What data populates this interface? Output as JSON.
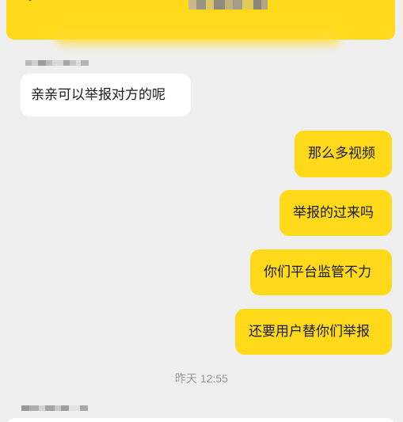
{
  "header": {
    "back_icon": "chevron-left-icon",
    "accent_color": "#ffd91a"
  },
  "messages": [
    {
      "side": "left",
      "text": "亲亲可以举报对方的呢"
    },
    {
      "side": "right",
      "text": "那么多视频"
    },
    {
      "side": "right",
      "text": "举报的过来吗"
    },
    {
      "side": "right",
      "text": "你们平台监管不力"
    },
    {
      "side": "right",
      "text": "还要用户替你们举报"
    }
  ],
  "timestamp": "昨天 12:55",
  "colors": {
    "background": "#efefef",
    "incoming_bubble": "#ffffff",
    "outgoing_bubble": "#ffd91a",
    "timestamp_text": "#9a9a9a"
  }
}
